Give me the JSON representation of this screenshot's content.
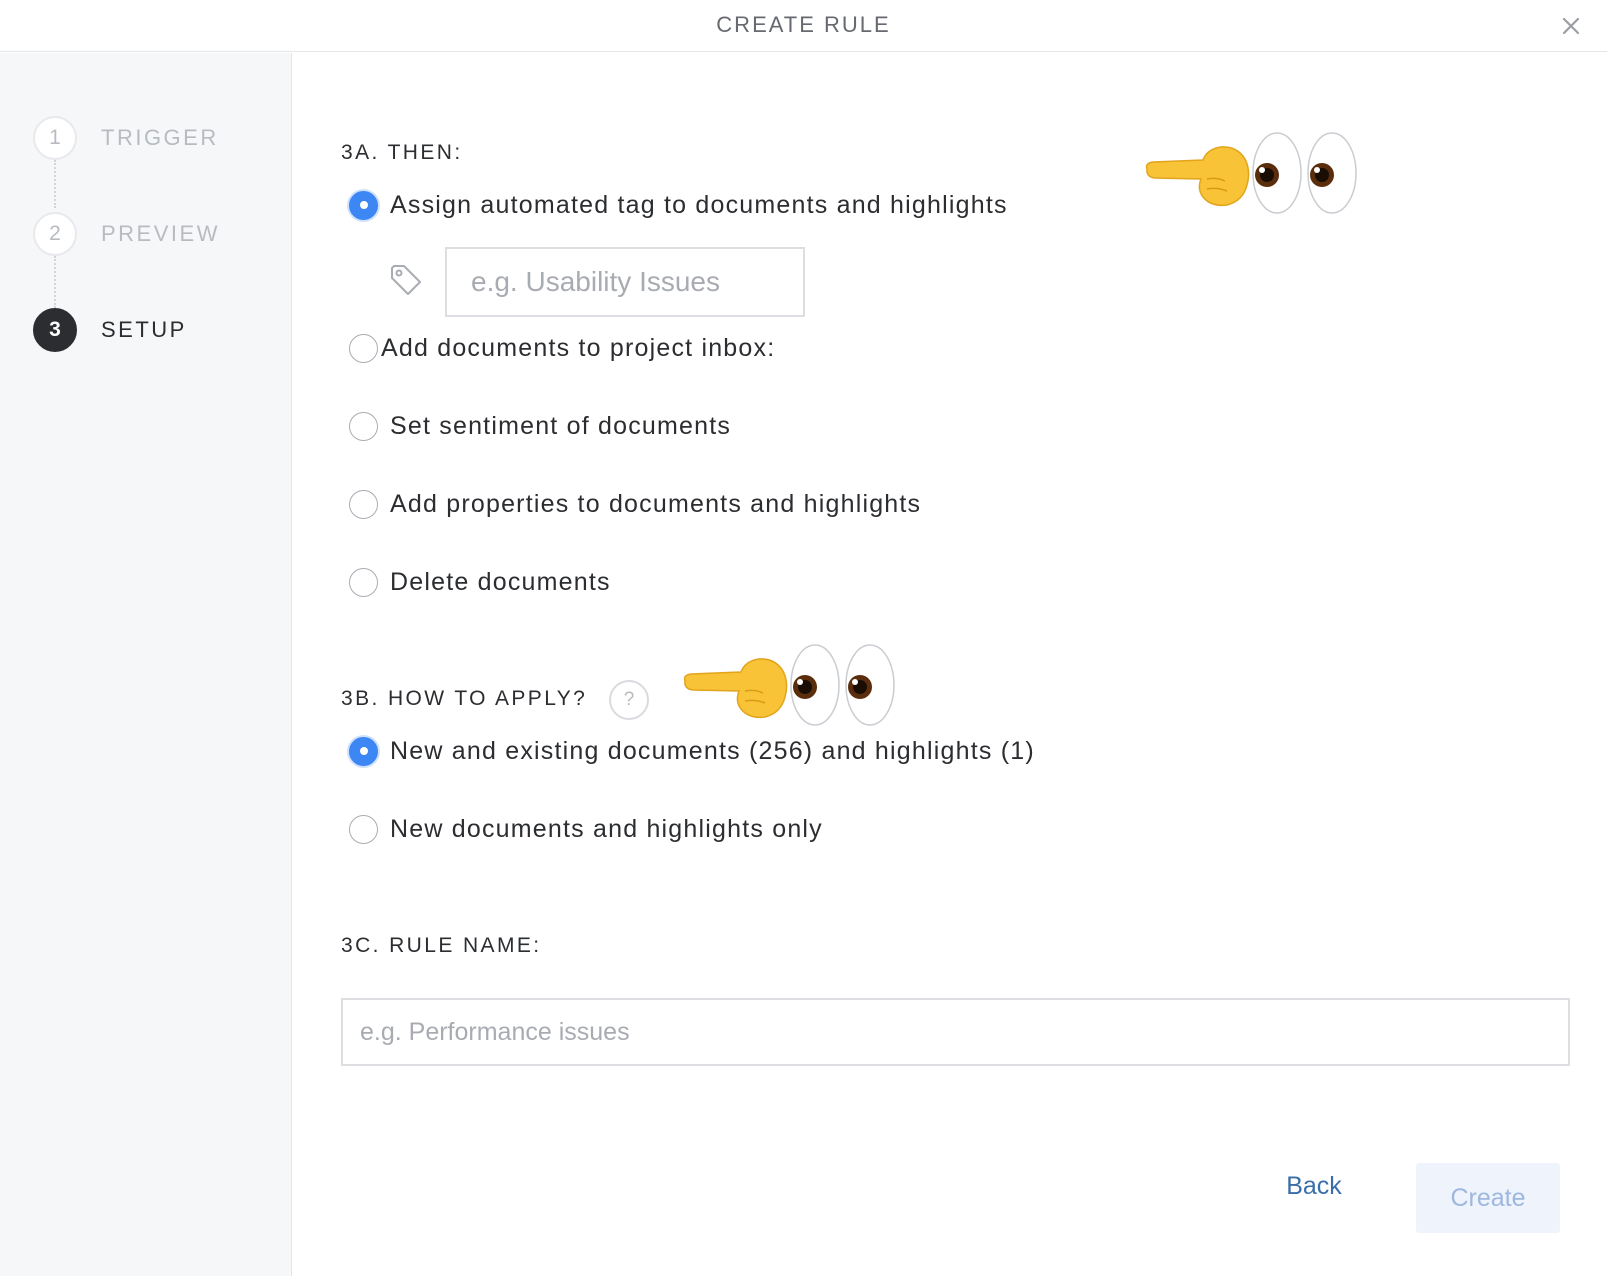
{
  "header": {
    "title": "CREATE RULE"
  },
  "steps": [
    {
      "number": "1",
      "label": "TRIGGER"
    },
    {
      "number": "2",
      "label": "PREVIEW"
    },
    {
      "number": "3",
      "label": "SETUP"
    }
  ],
  "section_a": {
    "title": "3A. THEN:",
    "options": [
      "Assign automated tag to documents and highlights",
      "Add documents to project inbox:",
      "Set sentiment of documents",
      "Add properties to documents and highlights",
      "Delete documents"
    ],
    "selected_index": 0,
    "tag_placeholder": "e.g. Usability Issues"
  },
  "section_b": {
    "title": "3B. HOW TO APPLY?",
    "help_symbol": "?",
    "options": [
      "New and existing documents (256) and highlights (1)",
      "New documents and highlights only"
    ],
    "selected_index": 0
  },
  "section_c": {
    "title": "3C. RULE NAME:",
    "placeholder": "e.g. Performance issues"
  },
  "buttons": {
    "back": "Back",
    "create": "Create"
  },
  "colors": {
    "accent": "#3d87f5",
    "link": "#3a6ea8",
    "disabled_text": "#9eb7de",
    "sidebar_bg": "#f6f7f9"
  },
  "icons": [
    "close-icon",
    "tag-icon",
    "help-icon",
    "pointing-hand-icon",
    "eyes-icon"
  ]
}
